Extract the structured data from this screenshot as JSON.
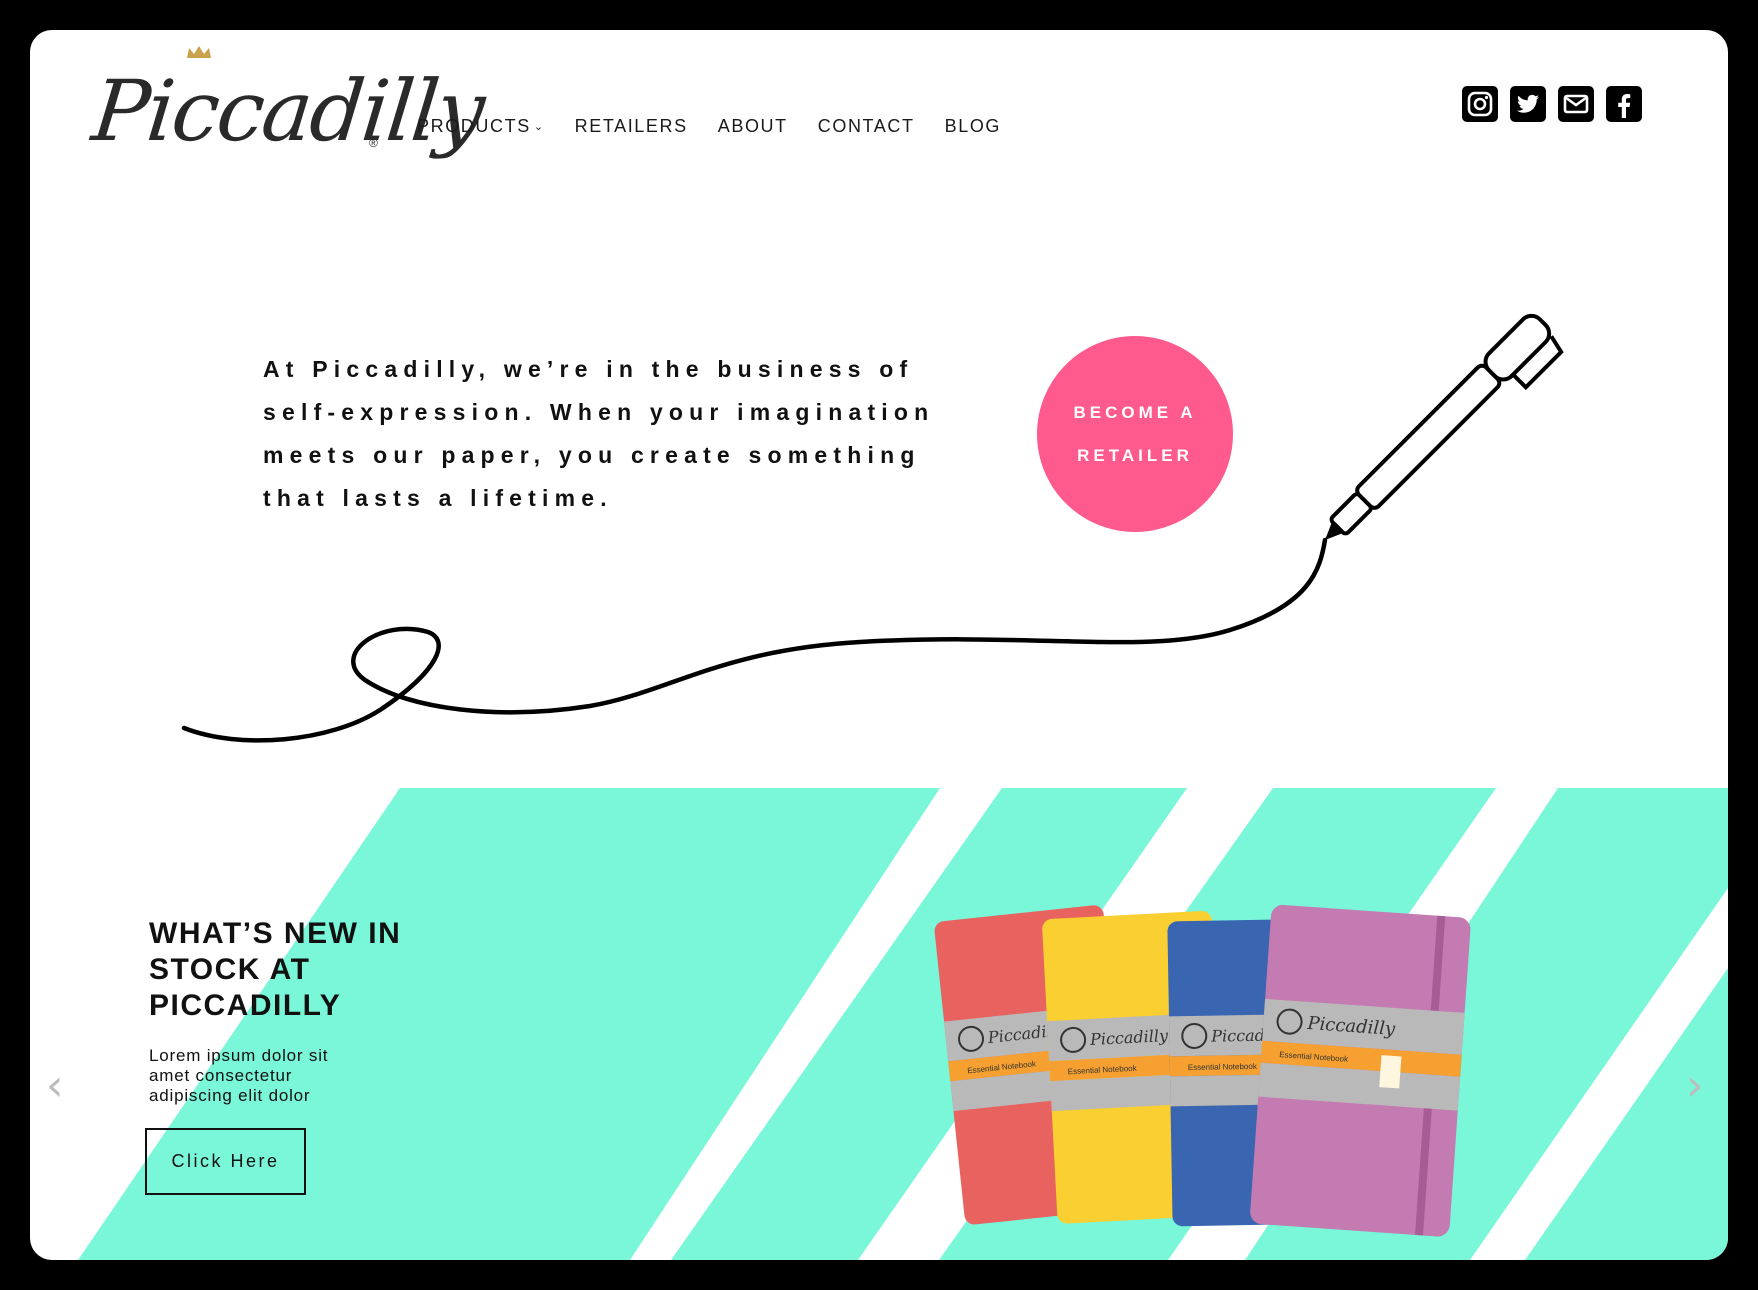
{
  "brand": {
    "name": "Piccadilly",
    "registered": "®"
  },
  "nav": {
    "items": [
      {
        "label": "PRODUCTS",
        "has_dropdown": true
      },
      {
        "label": "RETAILERS"
      },
      {
        "label": "ABOUT"
      },
      {
        "label": "CONTACT"
      },
      {
        "label": "BLOG"
      }
    ],
    "dropdown_icon": "chevron-down-icon"
  },
  "social": [
    "instagram-icon",
    "twitter-icon",
    "email-icon",
    "facebook-icon"
  ],
  "hero": {
    "text": "At Piccadilly, we’re in the business of self-expression. When your imagination meets our paper, you create something that lasts a lifetime.",
    "cta_label": "BECOME A RETAILER"
  },
  "promo": {
    "title": "WHAT’S NEW IN STOCK AT PICCADILLY",
    "body": "Lorem ipsum dolor sit amet consectetur adipiscing elit dolor",
    "button_label": "Click Here",
    "prev_icon": "chevron-left-icon",
    "next_icon": "chevron-right-icon",
    "notebooks": [
      {
        "color": "#e8625f",
        "band_title": "Piccadilly",
        "band_label": "Essential Notebook"
      },
      {
        "color": "#f9cf31",
        "band_title": "Piccadilly",
        "band_label": "Essential Notebook"
      },
      {
        "color": "#3a65b0",
        "band_title": "Piccadilly",
        "band_label": "Essential Notebook"
      },
      {
        "color": "#c47bb2",
        "band_title": "Piccadilly",
        "band_label": "Essential Notebook"
      }
    ]
  },
  "colors": {
    "accent_pink": "#ff5a8d",
    "stripe_mint": "#79f7d8",
    "text": "#111111"
  }
}
